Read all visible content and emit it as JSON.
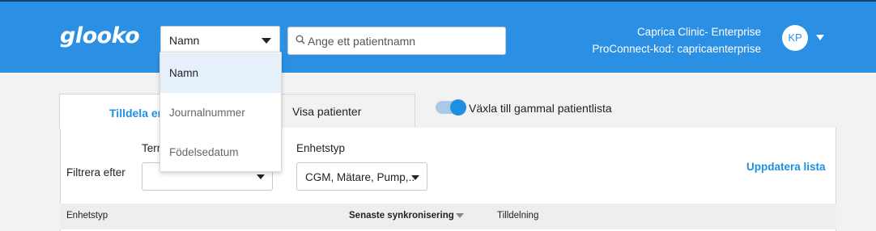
{
  "header": {
    "logo_text": "glooko",
    "search_type": {
      "selected": "Namn",
      "options": [
        "Namn",
        "Journalnummer",
        "Födelsedatum"
      ]
    },
    "search": {
      "placeholder": "Ange ett patientnamn",
      "value": ""
    },
    "clinic_name": "Caprica Clinic- Enterprise",
    "proconnect_code": "ProConnect-kod: capricaenterprise",
    "avatar_initials": "KP"
  },
  "tabs": [
    {
      "label": "Tilldela en",
      "active": true
    },
    {
      "label": "Visa patienter",
      "active": false
    }
  ],
  "toggle": {
    "label": "Växla till gammal patientlista",
    "on": true
  },
  "filters": {
    "label": "Filtrera efter",
    "term": {
      "label": "Terr",
      "value": ""
    },
    "device_type": {
      "label": "Enhetstyp",
      "value": "CGM, Mätare, Pump,.."
    },
    "refresh_label": "Uppdatera lista"
  },
  "table": {
    "columns": [
      {
        "label": "Enhetstyp"
      },
      {
        "label": "Senaste synkronisering",
        "sorted": true
      },
      {
        "label": "Tilldelning"
      }
    ]
  },
  "colors": {
    "header_bg": "#2b8fe3",
    "accent": "#1f8fe0",
    "top_line": "#14406b"
  }
}
